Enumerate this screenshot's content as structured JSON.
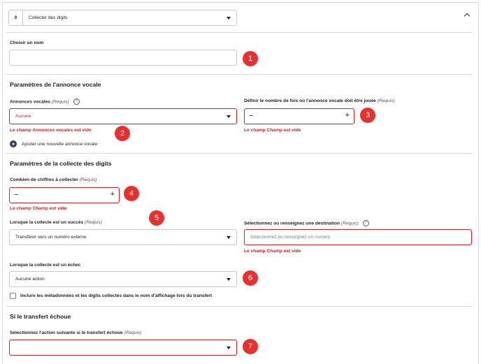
{
  "header": {
    "step_number": "0",
    "step_select_value": "Collecter des digits"
  },
  "name_section": {
    "label": "Choisir un nom",
    "value": ""
  },
  "voice_section": {
    "title": "Paramètres de l'annonce vocale",
    "announcements_label": "Annonces vocales",
    "required": "(Requis)",
    "announcements_value": "Aucune",
    "announcements_error": "Le champ Annonces vocales est vide",
    "add_announcement": "Ajouter une nouvelle annonce vocale",
    "play_count_label": "Définir le nombre de fois où l'annonce vocale doit être jouée",
    "play_count_error": "Le champ Champ est vide"
  },
  "digits_section": {
    "title": "Paramètres de la collecte des digits",
    "count_label": "Combien de chiffres à collecter",
    "count_error": "Le champ Champ est vide",
    "success_label": "Lorsque la collecte est un succès",
    "success_value": "Transférer vers un numéro externe",
    "destination_label": "Sélectionnez ou renseignez une destination",
    "destination_placeholder": "Sélectionnez ou renseignez un numéro",
    "destination_error": "Le champ Champ est vide",
    "failure_label": "Lorsque la collecte est un échec",
    "failure_value": "Aucune action",
    "metadata_checkbox_label": "Inclure les métadonnées et les digits collectés dans le nom d'affichage lors du transfert",
    "metadata_checked": false
  },
  "transfer_section": {
    "title": "Si le transfert échoue",
    "next_action_label": "Sélectionnez l'action suivante si le transfert échoue",
    "next_action_value": ""
  },
  "badges": [
    "1",
    "2",
    "3",
    "4",
    "5",
    "6",
    "7"
  ],
  "stepper": {
    "minus": "−",
    "plus": "+"
  },
  "help_glyph": "?",
  "add_glyph": "+",
  "colors": {
    "error": "#c6202a",
    "badge": "#e8302e",
    "add_icon": "#2b3a55"
  }
}
